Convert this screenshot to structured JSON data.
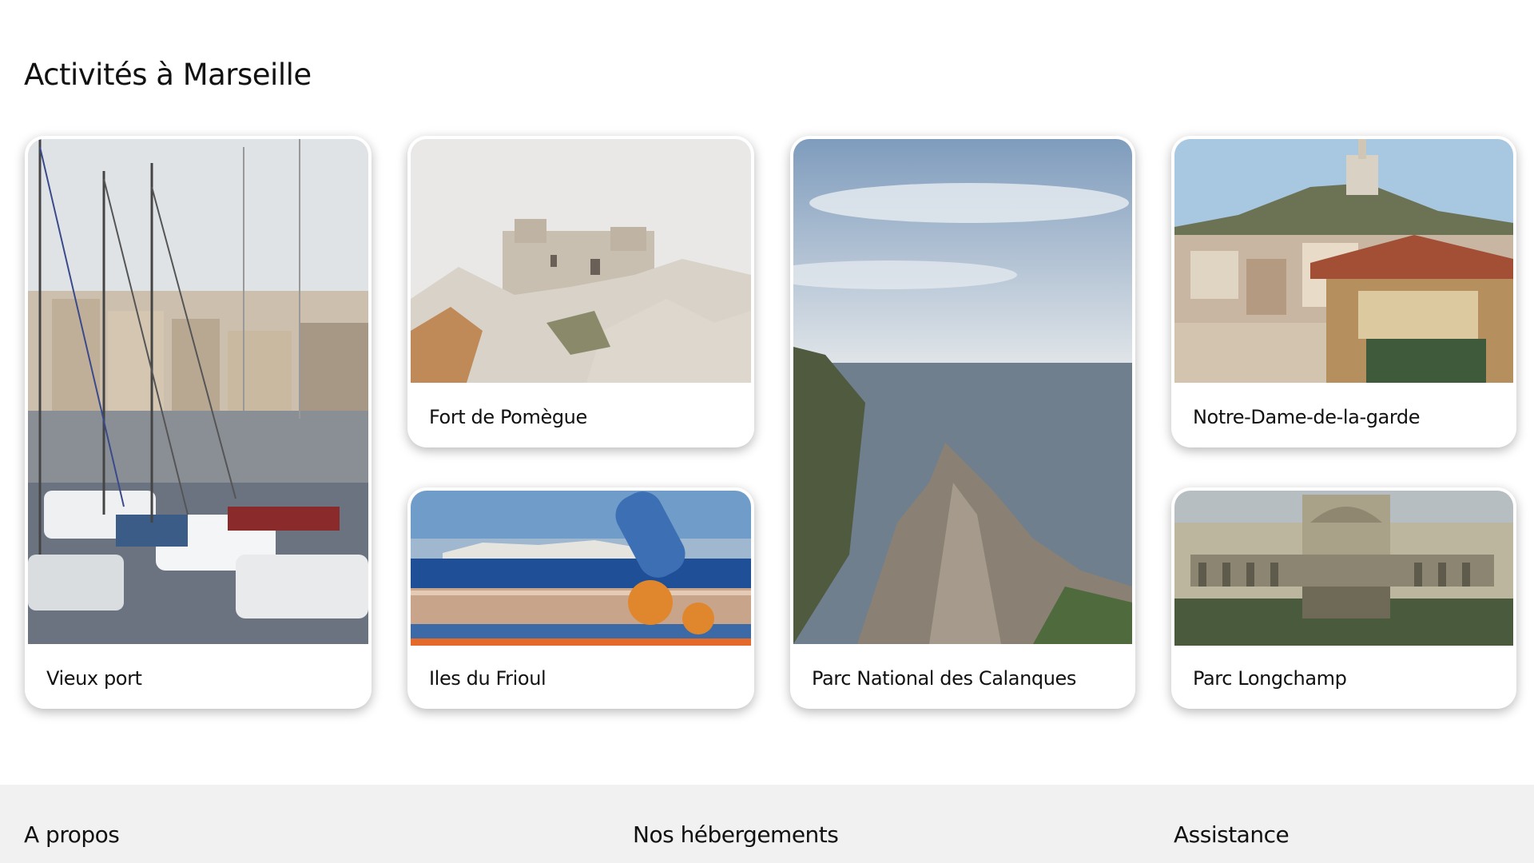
{
  "section": {
    "title": "Activités à Marseille"
  },
  "cards": [
    {
      "label": "Vieux port"
    },
    {
      "label": "Fort de Pomègue"
    },
    {
      "label": "Iles du Frioul"
    },
    {
      "label": "Parc National des Calanques"
    },
    {
      "label": "Notre-Dame-de-la-garde"
    },
    {
      "label": "Parc Longchamp"
    }
  ],
  "footer": {
    "about": "A propos",
    "accommodations": "Nos hébergements",
    "support": "Assistance"
  },
  "colors": {
    "background": "#ffffff",
    "footer_background": "#f1f1f1",
    "text": "#111111"
  }
}
